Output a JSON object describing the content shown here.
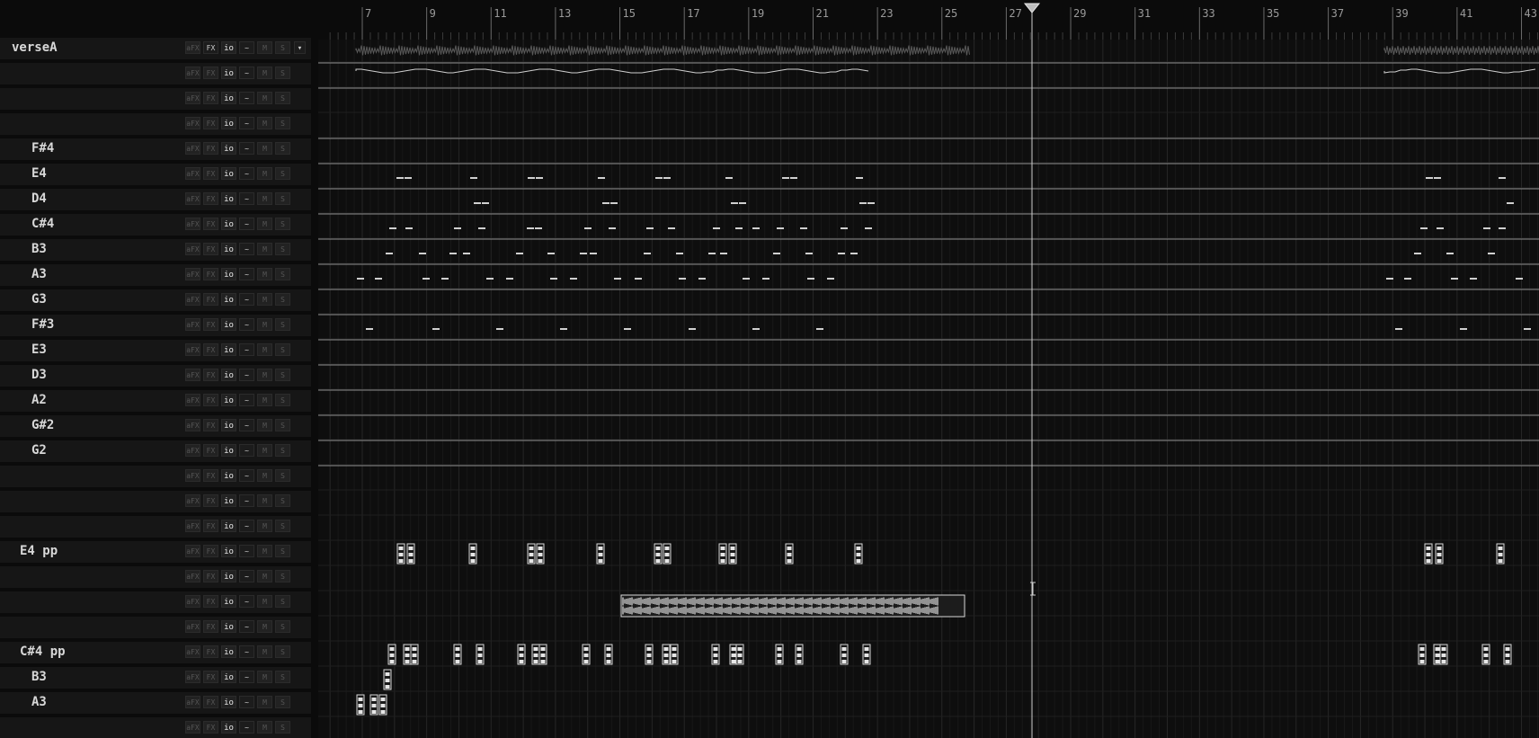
{
  "ruler": {
    "bars": [
      "7",
      "9",
      "11",
      "13",
      "15",
      "17",
      "19",
      "21",
      "23",
      "25",
      "27",
      "29",
      "31",
      "33",
      "35",
      "37",
      "39",
      "41",
      "43"
    ]
  },
  "track_buttons": {
    "afx": "aFX",
    "fx": "FX",
    "io": "io",
    "auto": "~",
    "mute": "M",
    "solo": "S"
  },
  "menu_icon": "chevron-down-icon",
  "tracks": [
    {
      "name": "verseA",
      "kind": "audio-lane",
      "fx_on": true
    },
    {
      "name": "",
      "kind": "melody-lane"
    },
    {
      "name": "",
      "kind": "empty"
    },
    {
      "name": "",
      "kind": "empty"
    },
    {
      "name": "F#4",
      "kind": "note-lane"
    },
    {
      "name": "E4",
      "kind": "note-lane"
    },
    {
      "name": "D4",
      "kind": "note-lane"
    },
    {
      "name": "C#4",
      "kind": "note-lane"
    },
    {
      "name": "B3",
      "kind": "note-lane"
    },
    {
      "name": "A3",
      "kind": "note-lane"
    },
    {
      "name": "G3",
      "kind": "note-lane"
    },
    {
      "name": "F#3",
      "kind": "note-lane"
    },
    {
      "name": "E3",
      "kind": "note-lane"
    },
    {
      "name": "D3",
      "kind": "note-lane"
    },
    {
      "name": "A2",
      "kind": "note-lane"
    },
    {
      "name": "G#2",
      "kind": "note-lane"
    },
    {
      "name": "G2",
      "kind": "note-lane"
    },
    {
      "name": "",
      "kind": "empty"
    },
    {
      "name": "",
      "kind": "empty"
    },
    {
      "name": "",
      "kind": "empty"
    },
    {
      "name": "E4 pp",
      "kind": "clip-lane"
    },
    {
      "name": "",
      "kind": "empty"
    },
    {
      "name": "",
      "kind": "waveform-clip"
    },
    {
      "name": "",
      "kind": "empty"
    },
    {
      "name": "C#4 pp",
      "kind": "clip-lane"
    },
    {
      "name": "B3",
      "kind": "clip-lane"
    },
    {
      "name": "A3",
      "kind": "clip-lane"
    },
    {
      "name": "",
      "kind": "empty"
    }
  ],
  "playhead_bar": 28,
  "colors": {
    "accent": "#d8d8d8",
    "background": "#0b0b0b",
    "row": "#161616",
    "lane_line": "#9a9a9a"
  }
}
